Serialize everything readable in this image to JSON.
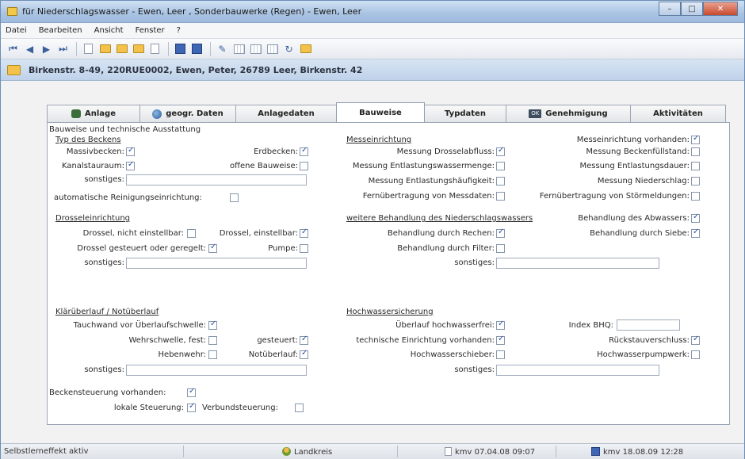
{
  "window": {
    "title": "für Niederschlagswasser - Ewen, Leer , Sonderbauwerke (Regen) - Ewen, Leer",
    "buttons": {
      "minimize": "–",
      "maximize": "□",
      "close": "✕"
    }
  },
  "menu": [
    "Datei",
    "Bearbeiten",
    "Ansicht",
    "Fenster",
    "?"
  ],
  "address": "Birkenstr. 8-49, 220RUE0002, Ewen, Peter, 26789 Leer, Birkenstr. 42",
  "tabs": [
    "Anlage",
    "geogr. Daten",
    "Anlagedaten",
    "Bauweise",
    "Typdaten",
    "Genehmigung",
    "Aktivitäten"
  ],
  "tab_ok_badge": "OK",
  "form": {
    "heading": "Bauweise und technische Ausstattung",
    "typ": {
      "header": "Typ des Beckens",
      "massivbecken": "Massivbecken:",
      "erdbecken": "Erdbecken:",
      "kanalstauraum": "Kanalstauraum:",
      "offene_bauweise": "offene Bauweise:",
      "sonstiges": "sonstiges:",
      "reinigung": "automatische Reinigungseinrichtung:"
    },
    "drossel": {
      "header": "Drosseleinrichtung",
      "nicht_einstellbar": "Drossel, nicht einstellbar:",
      "einstellbar": "Drossel, einstellbar:",
      "gesteuert": "Drossel gesteuert oder geregelt:",
      "pumpe": "Pumpe:",
      "sonstiges": "sonstiges:"
    },
    "klaer": {
      "header": "Klärüberlauf / Notüberlauf",
      "tauchwand": "Tauchwand vor Überlaufschwelle:",
      "wehrschwelle": "Wehrschwelle, fest:",
      "gesteuert": "gesteuert:",
      "hebenwehr": "Hebenwehr:",
      "notueberlauf": "Notüberlauf:",
      "sonstiges": "sonstiges:"
    },
    "steuerung": {
      "vorhanden": "Beckensteuerung vorhanden:",
      "lokal": "lokale Steuerung:",
      "verbund": "Verbundsteuerung:"
    },
    "mess": {
      "header": "Messeinrichtung",
      "vorhanden": "Messeinrichtung vorhanden:",
      "drosselabfluss": "Messung Drosselabfluss:",
      "beckenfuellstand": "Messung Beckenfüllstand:",
      "entlastungswassermenge": "Messung Entlastungswassermenge:",
      "entlastungsdauer": "Messung Entlastungsdauer:",
      "entlastungshaeufigkeit": "Messung Entlastungshäufigkeit:",
      "niederschlag": "Messung Niederschlag:",
      "fern_messdaten": "Fernübertragung von Messdaten:",
      "fern_stoermeldungen": "Fernübertragung von Störmeldungen:"
    },
    "behandlung": {
      "header": "weitere Behandlung des Niederschlagswassers",
      "abwasser": "Behandlung des Abwassers:",
      "rechen": "Behandlung durch Rechen:",
      "siebe": "Behandlung durch Siebe:",
      "filter": "Behandlung durch Filter:",
      "sonstiges": "sonstiges:"
    },
    "hochwasser": {
      "header": "Hochwassersicherung",
      "ueberlauf": "Überlauf hochwasserfrei:",
      "index_bhq": "Index BHQ:",
      "technisch": "technische Einrichtung vorhanden:",
      "rueckstau": "Rückstauverschluss:",
      "schieber": "Hochwasserschieber:",
      "pumpwerk": "Hochwasserpumpwerk:",
      "sonstiges": "sonstiges:"
    }
  },
  "checked": {
    "massivbecken": true,
    "erdbecken": true,
    "kanalstauraum": true,
    "offene_bauweise": false,
    "reinigung": false,
    "drossel_nicht": false,
    "drossel_einstellbar": true,
    "drossel_gesteuert": true,
    "pumpe": false,
    "tauchwand": true,
    "wehrschwelle": false,
    "klaer_gesteuert": true,
    "hebenwehr": false,
    "notueberlauf": true,
    "steuerung_vorhanden": true,
    "lokal": true,
    "verbund": false,
    "mess_vorhanden": true,
    "drosselabfluss": true,
    "beckenfuellstand": false,
    "entlastungswassermenge": false,
    "entlastungsdauer": false,
    "entlastungshaeufigkeit": false,
    "niederschlag": false,
    "fern_messdaten": false,
    "fern_stoermeldungen": false,
    "abwasser": true,
    "rechen": true,
    "siebe": true,
    "filter": false,
    "ueberlauf": true,
    "technisch": true,
    "rueckstau": true,
    "schieber": false,
    "pumpwerk": false
  },
  "status": {
    "left": "Selbstlerneffekt aktiv",
    "center": "Landkreis",
    "created": "kmv 07.04.08 09:07",
    "modified": "kmv 18.08.09 12:28"
  }
}
